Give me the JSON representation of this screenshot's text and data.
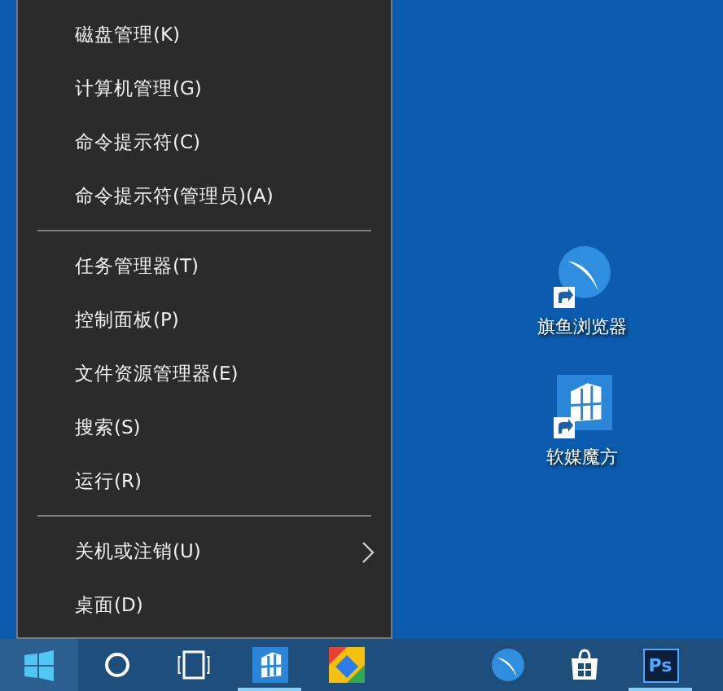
{
  "context_menu": {
    "groups": [
      {
        "items": [
          {
            "label": "磁盘管理(K)",
            "submenu": false
          },
          {
            "label": "计算机管理(G)",
            "submenu": false
          },
          {
            "label": "命令提示符(C)",
            "submenu": false
          },
          {
            "label": "命令提示符(管理员)(A)",
            "submenu": false
          }
        ]
      },
      {
        "items": [
          {
            "label": "任务管理器(T)",
            "submenu": false
          },
          {
            "label": "控制面板(P)",
            "submenu": false
          },
          {
            "label": "文件资源管理器(E)",
            "submenu": false
          },
          {
            "label": "搜索(S)",
            "submenu": false
          },
          {
            "label": "运行(R)",
            "submenu": false
          }
        ]
      },
      {
        "items": [
          {
            "label": "关机或注销(U)",
            "submenu": true
          },
          {
            "label": "桌面(D)",
            "submenu": false
          }
        ]
      }
    ]
  },
  "desktop_icons": [
    {
      "label": "旗鱼浏览器",
      "kind": "browser"
    },
    {
      "label": "软媒魔方",
      "kind": "cube"
    }
  ],
  "taskbar": {
    "items": [
      {
        "kind": "start",
        "running": false
      },
      {
        "kind": "cortana",
        "running": false
      },
      {
        "kind": "taskview",
        "running": false
      },
      {
        "kind": "cube",
        "running": true
      },
      {
        "kind": "colorful",
        "running": false
      },
      {
        "kind": "browser",
        "running": false
      },
      {
        "kind": "store",
        "running": false
      },
      {
        "kind": "ps",
        "label": "Ps",
        "running": true
      }
    ]
  }
}
